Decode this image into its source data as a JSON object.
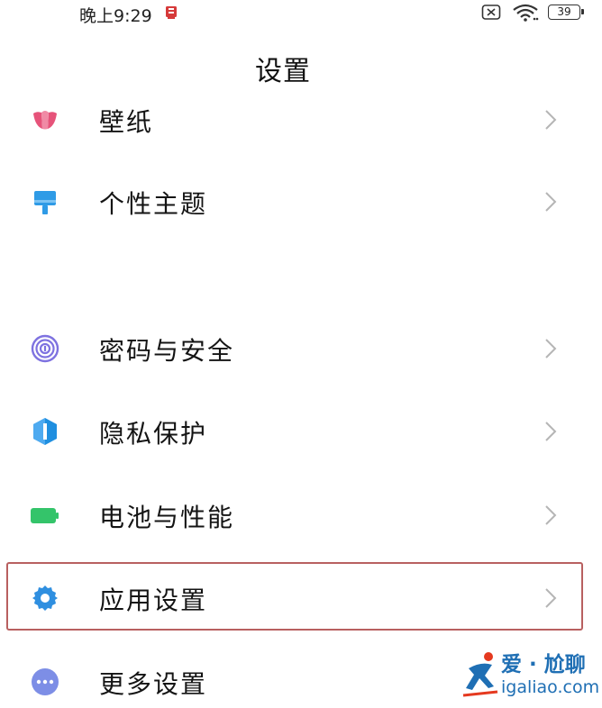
{
  "status_bar": {
    "time": "晚上9:29",
    "battery": "39",
    "icons": [
      "notification-icon",
      "sim-off-icon",
      "wifi-icon",
      "battery-icon"
    ]
  },
  "header": {
    "title": "设置"
  },
  "items": [
    {
      "label": "壁纸",
      "icon": "wallpaper-icon",
      "color": "#e6537a"
    },
    {
      "label": "个性主题",
      "icon": "theme-brush-icon",
      "color": "#2f9be6"
    },
    {
      "label": "密码与安全",
      "icon": "fingerprint-icon",
      "color": "#7e72e0"
    },
    {
      "label": "隐私保护",
      "icon": "privacy-shield-icon",
      "color": "#1f8fe0"
    },
    {
      "label": "电池与性能",
      "icon": "battery-performance-icon",
      "color": "#34c46a"
    },
    {
      "label": "应用设置",
      "icon": "gear-icon",
      "color": "#2f8fe0",
      "highlighted": true
    },
    {
      "label": "更多设置",
      "icon": "more-dots-icon",
      "color": "#7d8ee6"
    }
  ],
  "watermark": {
    "line1": "爱 · 尬聊",
    "line2": "igaliao.com"
  }
}
